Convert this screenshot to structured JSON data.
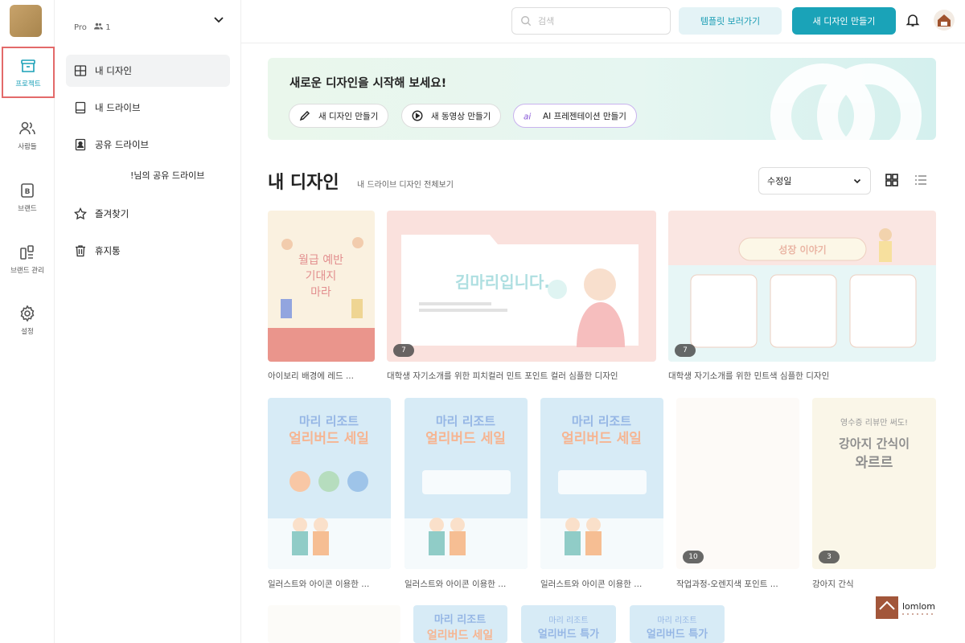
{
  "rail": {
    "items": [
      {
        "label": "프로젝트",
        "icon": "archive-box-icon"
      },
      {
        "label": "사람들",
        "icon": "people-icon"
      },
      {
        "label": "브랜드",
        "icon": "brand-b-icon"
      },
      {
        "label": "브랜드 관리",
        "icon": "brand-manage-icon"
      },
      {
        "label": "설정",
        "icon": "gear-icon"
      }
    ]
  },
  "workspace": {
    "plan": "Pro",
    "member_count": "1"
  },
  "subnav": {
    "items": [
      {
        "label": "내 디자인",
        "icon": "layout-icon"
      },
      {
        "label": "내 드라이브",
        "icon": "drive-icon"
      },
      {
        "label": "공유 드라이브",
        "icon": "shared-drive-icon"
      },
      {
        "label": "즐겨찾기",
        "icon": "star-icon"
      },
      {
        "label": "휴지통",
        "icon": "trash-icon"
      }
    ],
    "shared_drive_sub": "!님의 공유 드라이브"
  },
  "header": {
    "search_placeholder": "검색",
    "templates_button": "템플릿 보러가기",
    "create_button": "새 디자인 만들기"
  },
  "hero": {
    "title": "새로운 디자인을 시작해 보세요!",
    "buttons": [
      "새 디자인 만들기",
      "새 동영상 만들기",
      "AI 프레젠테이션 만들기"
    ]
  },
  "section": {
    "title": "내 디자인",
    "subtitle": "내 드라이브 디자인 전체보기",
    "sort_value": "수정일"
  },
  "designs": [
    {
      "title": "아이보리 배경에 레드 ...",
      "pages": ""
    },
    {
      "title": "대학생 자기소개를 위한 피치컬러 민트 포인트 컬러 심플한 디자인",
      "pages": "7"
    },
    {
      "title": "대학생 자기소개를 위한 민트색 심플한 디자인",
      "pages": "7"
    },
    {
      "title": "일러스트와 아이콘 이용한 ...",
      "pages": ""
    },
    {
      "title": "일러스트와 아이콘 이용한 ...",
      "pages": ""
    },
    {
      "title": "일러스트와 아이콘 이용한 ...",
      "pages": ""
    },
    {
      "title": "작업과정-오렌지색 포인트 ...",
      "pages": "10"
    },
    {
      "title": "강아지 간식",
      "pages": "3"
    }
  ],
  "thumb_text": {
    "ivory": [
      "월급 예반",
      "기대지",
      "마라"
    ],
    "intro": "김마리입니다.",
    "growth": "성장 이야기",
    "resort": [
      "마리 리조트",
      "얼리버드 세일"
    ],
    "dog": [
      "영수증 리뷰만 써도!",
      "강아지 간식이",
      "와르르"
    ],
    "early": [
      "마리 리조트",
      "얼리버드 특가"
    ]
  },
  "watermark": "lomlom",
  "colors": {
    "accent": "#1aa3b8",
    "highlight": "#e36a6a"
  }
}
